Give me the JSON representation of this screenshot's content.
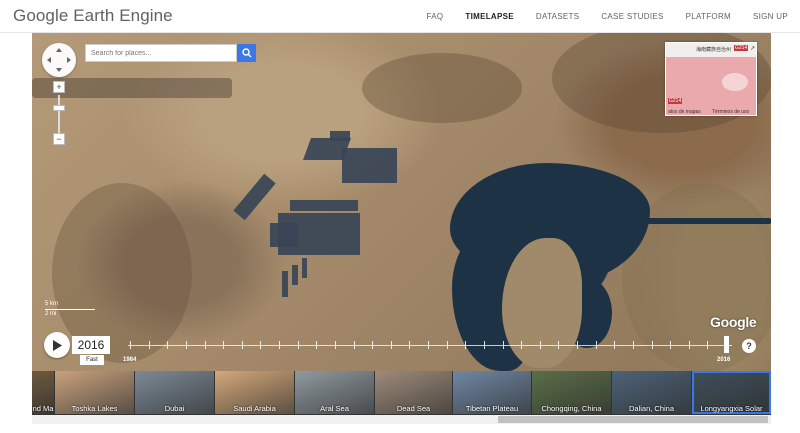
{
  "header": {
    "logo": "Google Earth Engine",
    "nav": [
      {
        "label": "FAQ",
        "active": false
      },
      {
        "label": "TIMELAPSE",
        "active": true
      },
      {
        "label": "DATASETS",
        "active": false
      },
      {
        "label": "CASE STUDIES",
        "active": false
      },
      {
        "label": "PLATFORM",
        "active": false
      },
      {
        "label": "SIGN UP",
        "active": false
      }
    ]
  },
  "search": {
    "placeholder": "Search for places..."
  },
  "minimap": {
    "label_top": "海南藏族自治州",
    "badge_top": "G214",
    "badge_bottom": "G214",
    "footer_left": "atos de mapas",
    "footer_right": "Términos de uso"
  },
  "scale": {
    "km": "5 km",
    "mi": "2 mi"
  },
  "watermark": "Google",
  "timeline": {
    "year": "2016",
    "speed": "Fast",
    "start_year": "1984",
    "end_year": "2016",
    "help": "?"
  },
  "thumbnails": [
    {
      "label": "nd Ma",
      "color": "#6d5a3e"
    },
    {
      "label": "Toshka Lakes",
      "color": "#c9a27e"
    },
    {
      "label": "Dubai",
      "color": "#7c8a96"
    },
    {
      "label": "Saudi Arabia",
      "color": "#d4a87a"
    },
    {
      "label": "Aral Sea",
      "color": "#8f9aa0"
    },
    {
      "label": "Dead Sea",
      "color": "#9e8b7a"
    },
    {
      "label": "Tibetan Plateau",
      "color": "#6f87a3"
    },
    {
      "label": "Chongqing, China",
      "color": "#5a6e48"
    },
    {
      "label": "Dalian, China",
      "color": "#4d6276"
    },
    {
      "label": "Longyangxia Solar",
      "color": "#3f4f5a",
      "selected": true
    }
  ],
  "colors": {
    "accent": "#3b78e7",
    "header_text": "#5f6368"
  }
}
